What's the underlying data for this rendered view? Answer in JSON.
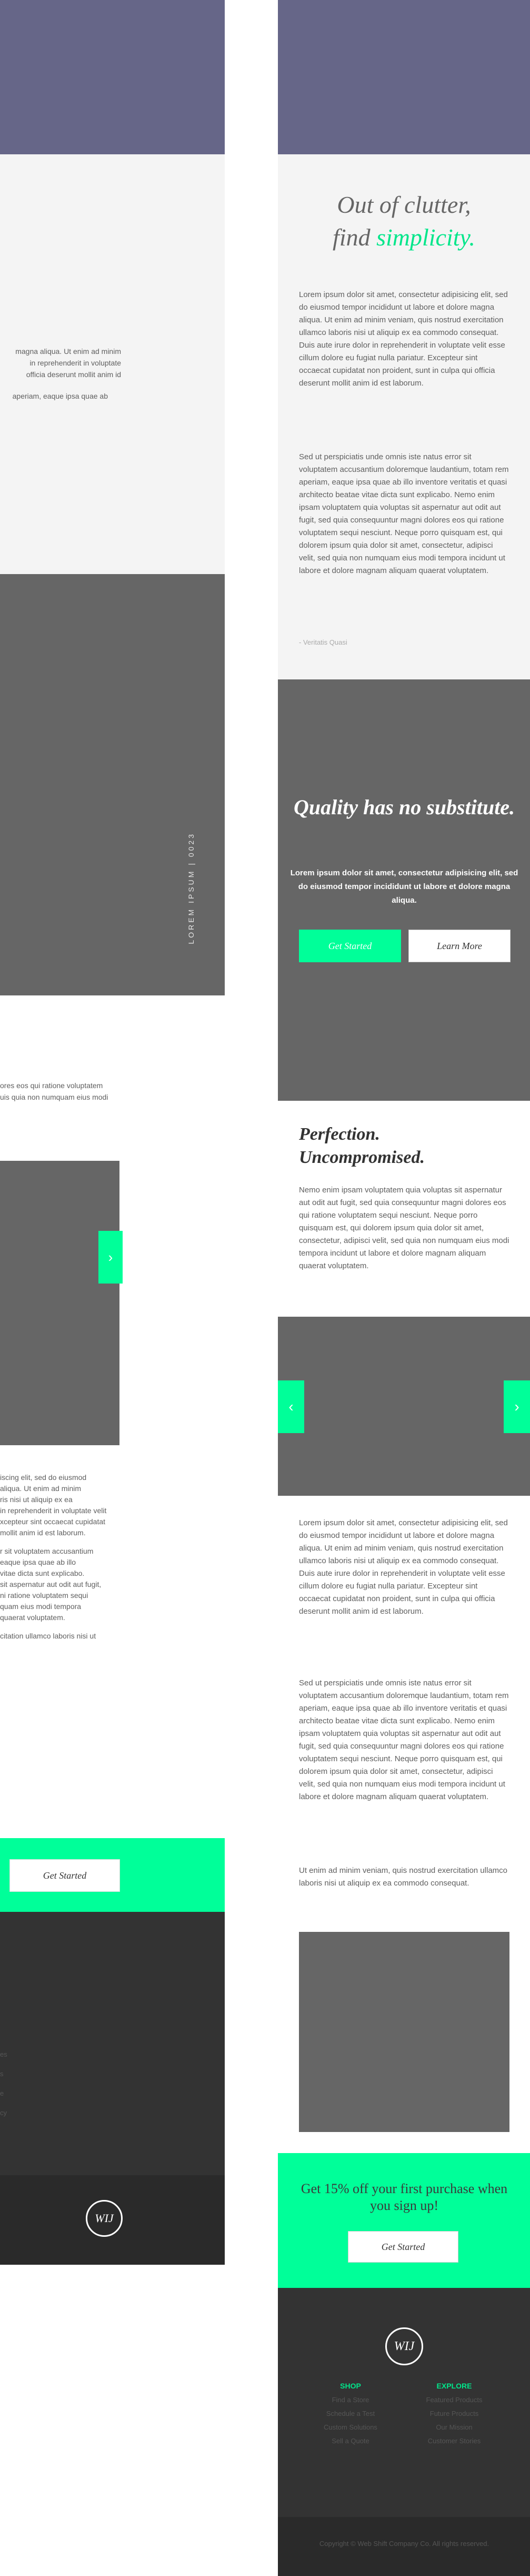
{
  "left_preview": {
    "intro_fragments": [
      "magna aliqua. Ut enim ad minim",
      "in reprehenderit in voluptate",
      "officia deserunt mollit anim id",
      "aperiam, eaque ipsa quae ab"
    ],
    "vertical_label": "LOREM IPSUM  |  0023",
    "perfection_fragments": [
      "ores eos qui ratione voluptatem",
      "uis quia non numquam eius modi"
    ],
    "slider_arrow": "›",
    "body_fragments": [
      "iscing elit, sed do eiusmod",
      "aliqua. Ut enim ad minim",
      "ris nisi ut aliquip ex ea",
      "in reprehenderit in voluptate velit",
      "xcepteur sint occaecat cupidatat",
      "mollit anim id est laborum.",
      "r sit voluptatem accusantium",
      "eaque ipsa quae ab illo",
      "vitae dicta sunt explicabo.",
      "sit aspernatur aut odit aut fugit,",
      "ni ratione voluptatem sequi",
      "quam eius modi tempora",
      "quaerat voluptatem.",
      "citation ullamco laboris nisi ut"
    ],
    "cta_label": "Get Started",
    "footer_fragments": [
      "es",
      "s",
      "e",
      "cy"
    ],
    "logo_text": "WIJ"
  },
  "intro": {
    "title_line1": "Out of clutter,",
    "title_line2_prefix": "find ",
    "title_line2_accent": "simplicity.",
    "paragraph1": "Lorem ipsum dolor sit amet, consectetur adipisicing elit, sed do eiusmod tempor incididunt ut labore et dolore magna aliqua. Ut enim ad minim veniam, quis nostrud exercitation ullamco laboris nisi ut aliquip ex ea commodo consequat. Duis aute irure dolor in reprehenderit in voluptate velit esse cillum dolore eu fugiat nulla pariatur. Excepteur sint occaecat cupidatat non proident, sunt in culpa qui officia deserunt mollit anim id est laborum.",
    "paragraph2": "Sed ut perspiciatis unde omnis iste natus error sit voluptatem accusantium doloremque laudantium, totam rem aperiam, eaque ipsa quae ab illo inventore veritatis et quasi architecto beatae vitae dicta sunt explicabo. Nemo enim ipsam voluptatem quia voluptas sit aspernatur aut odit aut fugit, sed quia consequuntur magni dolores eos qui ratione voluptatem sequi nesciunt. Neque porro quisquam est, qui dolorem ipsum quia dolor sit amet, consectetur, adipisci velit, sed quia non numquam eius modi tempora incidunt ut labore et dolore magnam aliquam quaerat voluptatem.",
    "attribution": "- Veritatis Quasi"
  },
  "quality": {
    "title": "Quality has no substitute.",
    "text": "Lorem ipsum dolor sit amet, consectetur adipisicing elit, sed do eiusmod tempor incididunt ut labore et dolore magna aliqua.",
    "btn_primary": "Get Started",
    "btn_secondary": "Learn More"
  },
  "perfection": {
    "title_line1": "Perfection.",
    "title_line2": "Uncompromised.",
    "text": "Nemo enim ipsam voluptatem quia voluptas sit aspernatur aut odit aut fugit, sed quia consequuntur magni dolores eos qui ratione voluptatem sequi nesciunt. Neque porro quisquam est, qui dolorem ipsum quia dolor sit amet, consectetur, adipisci velit, sed quia non numquam eius modi tempora incidunt ut labore et dolore magnam aliquam quaerat voluptatem."
  },
  "slider": {
    "prev_icon": "‹",
    "next_icon": "›"
  },
  "body": {
    "paragraph1": "Lorem ipsum dolor sit amet, consectetur adipisicing elit, sed do eiusmod tempor incididunt ut labore et dolore magna aliqua. Ut enim ad minim veniam, quis nostrud exercitation ullamco laboris nisi ut aliquip ex ea commodo consequat. Duis aute irure dolor in reprehenderit in voluptate velit esse cillum dolore eu fugiat nulla pariatur. Excepteur sint occaecat cupidatat non proident, sunt in culpa qui officia deserunt mollit anim id est laborum.",
    "paragraph2": "Sed ut perspiciatis unde omnis iste natus error sit voluptatem accusantium doloremque laudantium, totam rem aperiam, eaque ipsa quae ab illo inventore veritatis et quasi architecto beatae vitae dicta sunt explicabo. Nemo enim ipsam voluptatem quia voluptas sit aspernatur aut odit aut fugit, sed quia consequuntur magni dolores eos qui ratione voluptatem sequi nesciunt. Neque porro quisquam est, qui dolorem ipsum quia dolor sit amet, consectetur, adipisci velit, sed quia non numquam eius modi tempora incidunt ut labore et dolore magnam aliquam quaerat voluptatem.",
    "paragraph3": "Ut enim ad minim veniam, quis nostrud exercitation ullamco laboris nisi ut aliquip ex ea commodo consequat."
  },
  "signup": {
    "title": "Get 15% off your first purchase when you sign up!",
    "button": "Get Started"
  },
  "footer": {
    "logo_text": "WIJ",
    "shop_heading": "SHOP",
    "shop_links": [
      "Find a Store",
      "Schedule a Test",
      "Custom Solutions",
      "Sell a Quote"
    ],
    "explore_heading": "EXPLORE",
    "explore_links": [
      "Featured Products",
      "Future Products",
      "Our Mission",
      "Customer Stories"
    ],
    "copyright": "Copyright © Web Shift Company Co. All rights reserved."
  },
  "colors": {
    "accent": "#00ff99",
    "hero": "#666688",
    "dark": "#333333",
    "gray": "#666666",
    "light": "#f4f4f4"
  }
}
